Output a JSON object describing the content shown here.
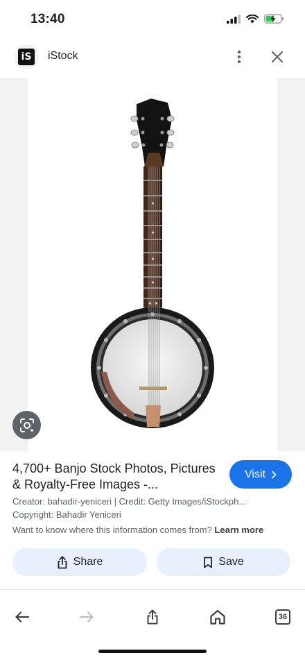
{
  "status_bar": {
    "time": "13:40",
    "battery": "charging"
  },
  "header": {
    "site_name": "iStock",
    "logo_text": "iS"
  },
  "image": {
    "subject": "banjo",
    "background": "#ffffff"
  },
  "result": {
    "title": "4,700+ Banjo Stock Photos, Pictures & Royalty-Free Images -...",
    "visit_label": "Visit",
    "creator_line": "Creator: bahadir-yeniceri | Credit: Getty Images/iStockph...",
    "copyright_line": "Copyright: Bahadir Yeniceri",
    "info_text": "Want to know where this information comes from?",
    "learn_more_label": "Learn more"
  },
  "actions": {
    "share_label": "Share",
    "save_label": "Save"
  },
  "bottom_nav": {
    "tab_count": "36"
  },
  "colors": {
    "accent": "#1a73e8",
    "chip_bg": "#e8f0fe",
    "text_secondary": "#5f6368"
  }
}
